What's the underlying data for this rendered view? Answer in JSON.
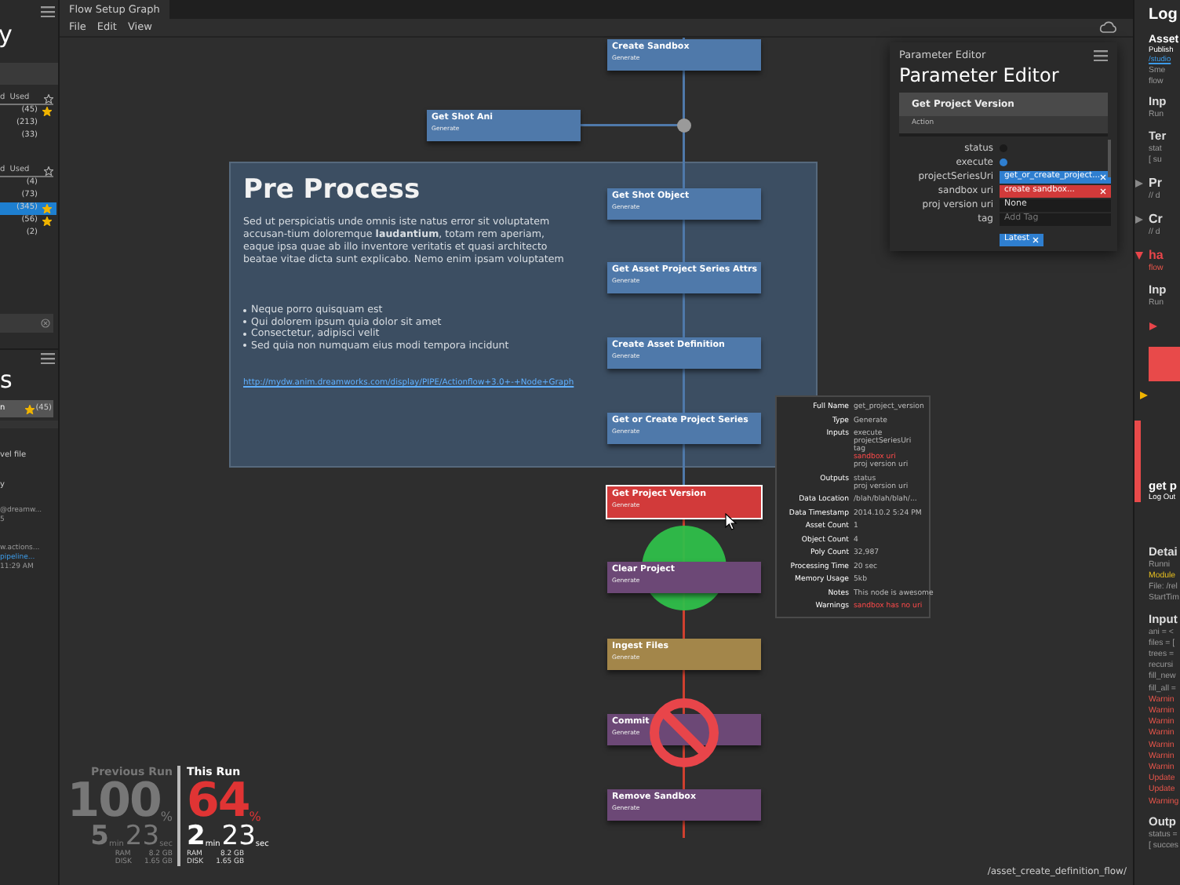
{
  "left_panel": {
    "heading": "y",
    "groups": [
      {
        "columns": [
          "d",
          "Used"
        ],
        "rows": [
          {
            "count": "(45)",
            "starred": true,
            "selected": false
          },
          {
            "count": "(213)",
            "starred": false,
            "selected": false
          },
          {
            "count": "(33)",
            "starred": false,
            "selected": false
          }
        ]
      },
      {
        "columns": [
          "d",
          "Used"
        ],
        "rows": [
          {
            "count": "(4)",
            "starred": false,
            "selected": false
          },
          {
            "count": "(73)",
            "starred": false,
            "selected": false
          },
          {
            "count": "(345)",
            "starred": true,
            "selected": true
          },
          {
            "count": "(56)",
            "starred": true,
            "selected": false
          },
          {
            "count": "(2)",
            "starred": false,
            "selected": false
          }
        ]
      }
    ],
    "heading_2": "s",
    "item": {
      "label": "n",
      "count": "(45)",
      "starred": true
    },
    "lines": [
      {
        "text": "vel file",
        "kind": "text"
      },
      {
        "text": "y",
        "kind": "text"
      },
      {
        "text": "@dreamw...",
        "kind": "meta"
      },
      {
        "text": "5",
        "kind": "meta"
      },
      {
        "text": "w.actions...",
        "kind": "meta"
      },
      {
        "text": "pipeline...",
        "kind": "link"
      },
      {
        "text": "11:29 AM",
        "kind": "meta"
      }
    ]
  },
  "window": {
    "title": "Flow Setup Graph",
    "menu": [
      "File",
      "Edit",
      "View"
    ]
  },
  "note": {
    "title": "Pre Process",
    "body": "Sed ut perspiciatis unde omnis iste natus error sit voluptatem accusan-tium doloremque **laudantium**, totam rem aperiam, eaque ipsa quae ab illo inventore veritatis et quasi architecto beatae vitae dicta sunt explicabo. Nemo enim ipsam voluptatem",
    "bullets": [
      "Neque porro quisquam est",
      "Qui dolorem ipsum quia dolor sit amet",
      "Consectetur, adipisci velit",
      "Sed quia non numquam eius modi tempora incidunt"
    ],
    "link": "http://mydw.anim.dreamworks.com/display/PIPE/Actionflow+3.0+-+Node+Graph"
  },
  "nodes": [
    {
      "name": "Create Sandbox",
      "type": "Generate",
      "color": "#4f79aa",
      "selected": false
    },
    {
      "name": "Get Shot Ani",
      "type": "Generate",
      "color": "#4f79aa",
      "selected": false
    },
    {
      "name": "Get Shot Object",
      "type": "Generate",
      "color": "#4f79aa",
      "selected": false
    },
    {
      "name": "Get Asset Project Series Attrs",
      "type": "Generate",
      "color": "#4f79aa",
      "selected": false
    },
    {
      "name": "Create Asset Definition",
      "type": "Generate",
      "color": "#4f79aa",
      "selected": false
    },
    {
      "name": "Get or Create Project Series",
      "type": "Generate",
      "color": "#4f79aa",
      "selected": false
    },
    {
      "name": "Get Project Version",
      "type": "Generate",
      "color": "#d23a3a",
      "selected": true
    },
    {
      "name": "Clear Project",
      "type": "Generate",
      "color": "#6c4876",
      "selected": false
    },
    {
      "name": "Ingest Files",
      "type": "Generate",
      "color": "#a3864a",
      "selected": false
    },
    {
      "name": "Commit",
      "type": "Generate",
      "color": "#6c4876",
      "selected": false
    },
    {
      "name": "Remove Sandbox",
      "type": "Generate",
      "color": "#6c4876",
      "selected": false
    }
  ],
  "parameter_editor": {
    "caption": "Parameter Editor",
    "title": "Parameter Editor",
    "node": "Get Project Version",
    "category": "Action",
    "params": [
      {
        "label": "status",
        "kind": "dot",
        "on": false
      },
      {
        "label": "execute",
        "kind": "dot",
        "on": true
      },
      {
        "label": "projectSeriesUri",
        "kind": "chip",
        "value": "get_or_create_project...",
        "color": "#2f7fd0"
      },
      {
        "label": "sandbox uri",
        "kind": "chip",
        "value": "create sandbox...",
        "color": "#d23a3a"
      },
      {
        "label": "proj version uri",
        "kind": "field",
        "value": "None"
      },
      {
        "label": "tag",
        "kind": "field",
        "placeholder": "Add Tag"
      }
    ],
    "tag": "Latest"
  },
  "node_info": [
    {
      "label": "Full Name",
      "values": [
        {
          "text": "get_project_version",
          "error": false
        }
      ]
    },
    {
      "label": "Type",
      "values": [
        {
          "text": "Generate",
          "error": false
        }
      ]
    },
    {
      "label": "Inputs",
      "values": [
        {
          "text": "execute",
          "error": false
        },
        {
          "text": "projectSeriesUri",
          "error": false
        },
        {
          "text": "tag",
          "error": false
        },
        {
          "text": "sandbox uri",
          "error": true
        },
        {
          "text": "proj version uri",
          "error": false
        }
      ]
    },
    {
      "label": "Outputs",
      "values": [
        {
          "text": "status",
          "error": false
        },
        {
          "text": "proj version uri",
          "error": false
        }
      ]
    },
    {
      "label": "Data Location",
      "values": [
        {
          "text": "/blah/blah/blah/...",
          "error": false
        }
      ]
    },
    {
      "label": "Data Timestamp",
      "values": [
        {
          "text": "2014.10.2   5:24 PM",
          "error": false
        }
      ]
    },
    {
      "label": "Asset Count",
      "values": [
        {
          "text": "1",
          "error": false
        }
      ]
    },
    {
      "label": "Object Count",
      "values": [
        {
          "text": "4",
          "error": false
        }
      ]
    },
    {
      "label": "Poly Count",
      "values": [
        {
          "text": "32,987",
          "error": false
        }
      ]
    },
    {
      "label": "Processing Time",
      "values": [
        {
          "text": "20 sec",
          "error": false
        }
      ]
    },
    {
      "label": "Memory Usage",
      "values": [
        {
          "text": "5kb",
          "error": false
        }
      ]
    },
    {
      "label": "Notes",
      "values": [
        {
          "text": "This node is awesome",
          "error": false
        }
      ]
    },
    {
      "label": "Warnings",
      "values": [
        {
          "text": "sandbox has no uri",
          "error": true
        }
      ]
    }
  ],
  "runs": [
    {
      "label": "Previous Run",
      "percent": "100",
      "percent_unit": "%",
      "minutes": "5",
      "min_unit": "min",
      "seconds": "23",
      "sec_unit": "sec",
      "ram_label": "RAM",
      "ram": "8.2 GB",
      "disk_label": "DISK",
      "disk": "1.65 GB",
      "current": false
    },
    {
      "label": "This Run",
      "percent": "64",
      "percent_unit": "%",
      "minutes": "2",
      "min_unit": "min",
      "seconds": "23",
      "sec_unit": "sec",
      "ram_label": "RAM",
      "ram": "8.2 GB",
      "disk_label": "DISK",
      "disk": "1.65 GB",
      "current": true
    }
  ],
  "path": "/asset_create_definition_flow/",
  "log_panel": [
    {
      "text": "Log",
      "kind": "title"
    },
    {
      "text": "Asset",
      "kind": "bold"
    },
    {
      "text": "Publish",
      "kind": "small"
    },
    {
      "text": "/studio",
      "kind": "link"
    },
    {
      "text": "Sme",
      "kind": "text"
    },
    {
      "text": "flow",
      "kind": "text"
    },
    {
      "text": "Inp",
      "kind": "heading"
    },
    {
      "text": "Run",
      "kind": "text"
    },
    {
      "text": "Ter",
      "kind": "heading"
    },
    {
      "text": "stat",
      "kind": "text"
    },
    {
      "text": "[ su",
      "kind": "text"
    },
    {
      "text": "Pr",
      "kind": "section"
    },
    {
      "text": "// d",
      "kind": "text"
    },
    {
      "text": "Cr",
      "kind": "section"
    },
    {
      "text": "// d",
      "kind": "text"
    },
    {
      "text": "ha",
      "kind": "error-section"
    },
    {
      "text": "flow",
      "kind": "error"
    },
    {
      "text": "Inp",
      "kind": "heading"
    },
    {
      "text": "Run",
      "kind": "text"
    },
    {
      "text": "get p",
      "kind": "entry"
    },
    {
      "text": "Log Out",
      "kind": "small"
    },
    {
      "text": "Detai",
      "kind": "heading"
    },
    {
      "text": "Runni",
      "kind": "text"
    },
    {
      "text": "Module",
      "kind": "notice"
    },
    {
      "text": "File: /rel",
      "kind": "text"
    },
    {
      "text": "StartTim",
      "kind": "text"
    },
    {
      "text": "Input",
      "kind": "heading"
    },
    {
      "text": "ani = <",
      "kind": "text"
    },
    {
      "text": "files = [",
      "kind": "text"
    },
    {
      "text": "trees =",
      "kind": "text"
    },
    {
      "text": "recursi",
      "kind": "text"
    },
    {
      "text": "fill_new",
      "kind": "text"
    },
    {
      "text": "fill_all =",
      "kind": "text"
    },
    {
      "text": "Warnin",
      "kind": "error"
    },
    {
      "text": "Warnin",
      "kind": "error"
    },
    {
      "text": "Warnin",
      "kind": "error"
    },
    {
      "text": "Warnin",
      "kind": "error"
    },
    {
      "text": "Warnin",
      "kind": "error"
    },
    {
      "text": "Warnin",
      "kind": "error"
    },
    {
      "text": "Warnin",
      "kind": "error"
    },
    {
      "text": "Update",
      "kind": "error"
    },
    {
      "text": "Update",
      "kind": "error"
    },
    {
      "text": "Warning",
      "kind": "error"
    },
    {
      "text": "Outp",
      "kind": "heading"
    },
    {
      "text": "status =",
      "kind": "text"
    },
    {
      "text": "[ succes",
      "kind": "text"
    }
  ]
}
